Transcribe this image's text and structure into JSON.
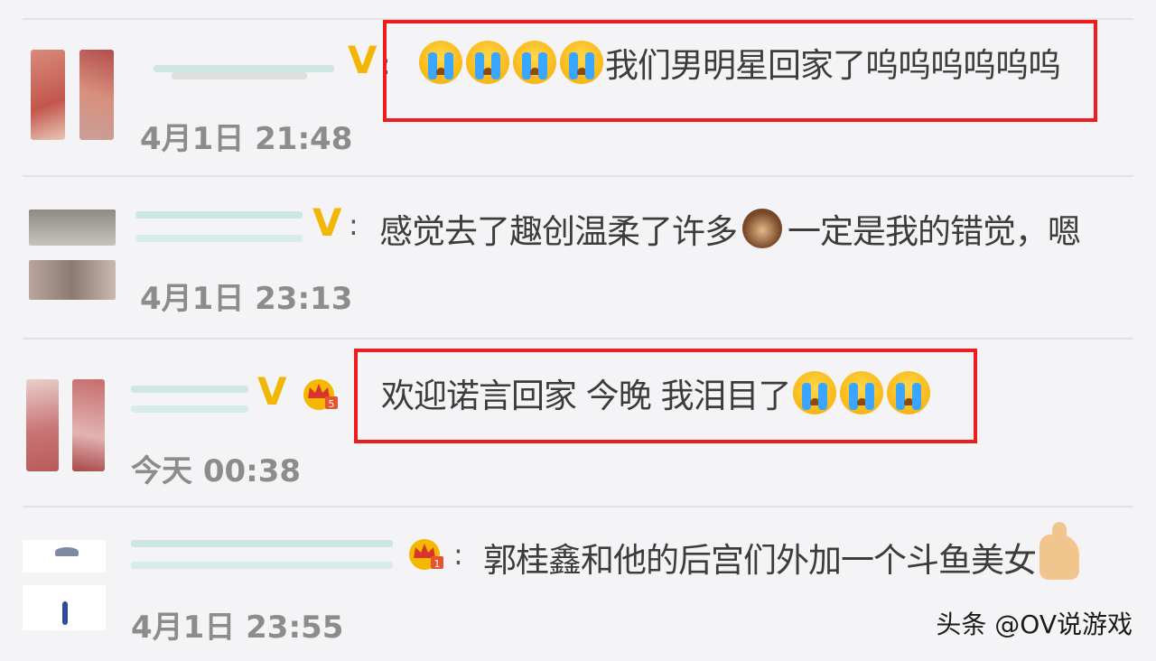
{
  "comments": [
    {
      "text": "我们男明星回家了呜呜呜呜呜呜",
      "time": "4月1日 21:48",
      "emoji_before": [
        "crying-face",
        "crying-face",
        "crying-face",
        "crying-face"
      ],
      "highlighted": true
    },
    {
      "text_a": "感觉去了趣创温柔了许多",
      "text_b": "一定是我的错觉，嗯",
      "time": "4月1日 23:13",
      "emoji_mid": "see-no-evil-monkey",
      "highlighted": false
    },
    {
      "text": "欢迎诺言回家 今晚 我泪目了",
      "time": "今天 00:38",
      "emoji_after": [
        "crying-face",
        "crying-face",
        "crying-face"
      ],
      "highlighted": true
    },
    {
      "text": "郭桂鑫和他的后宫们外加一个斗鱼美女",
      "time": "4月1日 23:55",
      "emoji_after": "thumbs-up",
      "highlighted": false
    }
  ],
  "badges": {
    "v": "V",
    "colon": ":"
  },
  "colors": {
    "highlight": "#ee1c1c",
    "v_badge": "#f2b705",
    "timestamp": "#8c8c8c"
  },
  "watermark": "头条 @OV说游戏"
}
